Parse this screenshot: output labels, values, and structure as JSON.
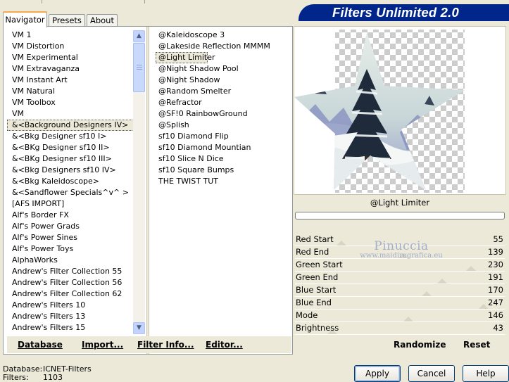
{
  "app_title": "Filters Unlimited 2.0",
  "tabs": [
    {
      "label": "Navigator",
      "active": true
    },
    {
      "label": "Presets",
      "active": false
    },
    {
      "label": "About",
      "active": false
    }
  ],
  "categories": [
    {
      "label": "VM 1",
      "selected": false
    },
    {
      "label": "VM Distortion",
      "selected": false
    },
    {
      "label": "VM Experimental",
      "selected": false
    },
    {
      "label": "VM Extravaganza",
      "selected": false
    },
    {
      "label": "VM Instant Art",
      "selected": false
    },
    {
      "label": "VM Natural",
      "selected": false
    },
    {
      "label": "VM Toolbox",
      "selected": false
    },
    {
      "label": "VM",
      "selected": false
    },
    {
      "label": "&<Background Designers IV>",
      "selected": true
    },
    {
      "label": "&<Bkg Designer sf10 I>",
      "selected": false
    },
    {
      "label": "&<BKg Designer sf10 II>",
      "selected": false
    },
    {
      "label": "&<BKg Designer sf10 III>",
      "selected": false
    },
    {
      "label": "&<Bkg Designers sf10 IV>",
      "selected": false
    },
    {
      "label": "&<Bkg Kaleidoscope>",
      "selected": false
    },
    {
      "label": "&<Sandflower Specials^v^ >",
      "selected": false
    },
    {
      "label": "[AFS IMPORT]",
      "selected": false
    },
    {
      "label": "Alf's Border FX",
      "selected": false
    },
    {
      "label": "Alf's Power Grads",
      "selected": false
    },
    {
      "label": "Alf's Power Sines",
      "selected": false
    },
    {
      "label": "Alf's Power Toys",
      "selected": false
    },
    {
      "label": "AlphaWorks",
      "selected": false
    },
    {
      "label": "Andrew's Filter Collection 55",
      "selected": false
    },
    {
      "label": "Andrew's Filter Collection 56",
      "selected": false
    },
    {
      "label": "Andrew's Filter Collection 62",
      "selected": false
    },
    {
      "label": "Andrew's Filters 10",
      "selected": false
    },
    {
      "label": "Andrew's Filters 13",
      "selected": false
    },
    {
      "label": "Andrew's Filters 15",
      "selected": false
    }
  ],
  "filters": [
    {
      "label": "@Kaleidoscope 3",
      "selected": false
    },
    {
      "label": "@Lakeside Reflection MMMM",
      "selected": false
    },
    {
      "label": "@Light Limiter",
      "selected": true
    },
    {
      "label": "@Night Shadow Pool",
      "selected": false
    },
    {
      "label": "@Night Shadow",
      "selected": false
    },
    {
      "label": "@Random Smelter",
      "selected": false
    },
    {
      "label": "@Refractor",
      "selected": false
    },
    {
      "label": "@SF!0 RainbowGround",
      "selected": false
    },
    {
      "label": "@Splish",
      "selected": false
    },
    {
      "label": "sf10 Diamond Flip",
      "selected": false
    },
    {
      "label": "sf10 Diamond Mountian",
      "selected": false
    },
    {
      "label": "sf10 Slice N Dice",
      "selected": false
    },
    {
      "label": "sf10 Square Bumps",
      "selected": false
    },
    {
      "label": "THE TWIST TUT",
      "selected": false
    }
  ],
  "left_buttons": {
    "database": "Database",
    "import": "Import...",
    "filter_info": "Filter Info...",
    "editor": "Editor..."
  },
  "current_filter": "@Light Limiter",
  "params": [
    {
      "label": "Red Start",
      "value": 55
    },
    {
      "label": "Red End",
      "value": 139
    },
    {
      "label": "Green  Start",
      "value": 230
    },
    {
      "label": "Green End",
      "value": 191
    },
    {
      "label": "Blue Start",
      "value": 170
    },
    {
      "label": "Blue End",
      "value": 247
    },
    {
      "label": "Mode",
      "value": 146
    },
    {
      "label": "Brightness",
      "value": 43
    }
  ],
  "param_max": 255,
  "watermark": {
    "line1": "Pinuccia",
    "line2": "www.maidiregrafica.eu"
  },
  "right_buttons": {
    "randomize": "Randomize",
    "reset": "Reset"
  },
  "info": {
    "database_label": "Database:",
    "database_value": "ICNET-Filters",
    "filters_label": "Filters:",
    "filters_value": "1103"
  },
  "dialog_buttons": {
    "apply": "Apply",
    "cancel": "Cancel",
    "help": "Help"
  },
  "colors": {
    "banner": "#00268c",
    "dialog_bg": "#ece9d8",
    "active_tab_accent": "#f9a84c"
  }
}
